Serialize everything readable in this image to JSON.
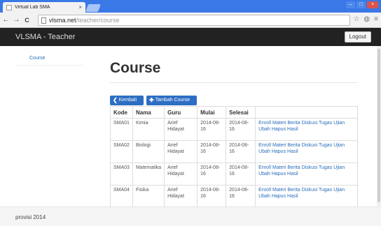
{
  "browser": {
    "tab_title": "Virtual Lab SMA",
    "tab_close": "×",
    "url_host": "vlsma.net",
    "url_path": "/teacher/course",
    "back_icon": "←",
    "forward_icon": "→",
    "reload_icon": "C",
    "star_icon": "☆",
    "menu_icon": "≡",
    "minimize": "–",
    "maximize": "□",
    "close": "×"
  },
  "navbar": {
    "brand": "VLSMA - Teacher",
    "logout_label": "Logout"
  },
  "sidebar": {
    "items": [
      {
        "label": "Course"
      }
    ]
  },
  "main": {
    "title": "Course",
    "back_glyph": "❮",
    "back_label": "Kembali",
    "add_glyph": "✚",
    "add_label": "Tambah Course"
  },
  "table": {
    "headers": [
      "Kode",
      "Nama",
      "Guru",
      "Mulai",
      "Selesai",
      ""
    ],
    "rows": [
      {
        "kode": "SMA01",
        "nama": "Kimia",
        "guru": "Arief Hidayat",
        "mulai": "2014-08-16",
        "selesai": "2014-08-16",
        "actions": "Enroll Materi Berita Diskusi Tugas Ujian Ubah Hapus Hasil"
      },
      {
        "kode": "SMA02",
        "nama": "Biologi",
        "guru": "Arief Hidayat",
        "mulai": "2014-08-16",
        "selesai": "2014-08-16",
        "actions": "Enroll Materi Berita Diskusi Tugas Ujian Ubah Hapus Hasil"
      },
      {
        "kode": "SMA03",
        "nama": "Matematika",
        "guru": "Arief Hidayat",
        "mulai": "2014-08-16",
        "selesai": "2014-08-16",
        "actions": "Enroll Materi Berita Diskusi Tugas Ujian Ubah Hapus Hasil"
      },
      {
        "kode": "SMA04",
        "nama": "Fisika",
        "guru": "Arief Hidayat",
        "mulai": "2014-08-16",
        "selesai": "2014-08-16",
        "actions": "Enroll Materi Berita Diskusi Tugas Ujian Ubah Hapus Hasil"
      }
    ]
  },
  "footer": {
    "text": "provisi 2014"
  },
  "colors": {
    "link": "#2a6ebb",
    "primary_button": "#2d6ec4",
    "navbar": "#222222",
    "tabbar": "#3b78e7"
  }
}
